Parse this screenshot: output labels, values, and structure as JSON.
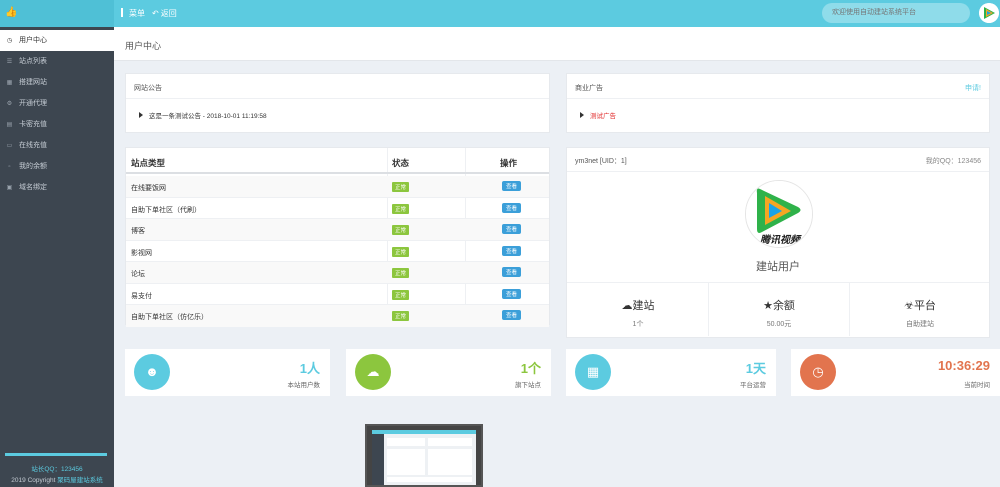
{
  "header": {
    "menu_label": "菜单",
    "back_label": "返回",
    "search_placeholder": "欢迎使用自动建站系统平台"
  },
  "sidebar": {
    "items": [
      {
        "label": "用户中心",
        "icon": "clock-icon"
      },
      {
        "label": "站点列表",
        "icon": "list-icon"
      },
      {
        "label": "搭建网站",
        "icon": "cart-icon"
      },
      {
        "label": "开通代理",
        "icon": "gear-icon"
      },
      {
        "label": "卡密充值",
        "icon": "document-icon"
      },
      {
        "label": "在线充值",
        "icon": "card-icon"
      },
      {
        "label": "我的余额",
        "icon": "wallet-icon"
      },
      {
        "label": "域名绑定",
        "icon": "lock-icon"
      }
    ],
    "qq_text": "站长QQ：123456",
    "copyright_prefix": "2019 Copyright",
    "copyright_link": "聚码屋建站系统"
  },
  "page": {
    "title": "用户中心"
  },
  "announcement": {
    "title": "网站公告",
    "item": "这是一条测试公告 - 2018-10-01 11:19:58"
  },
  "ads": {
    "title": "商业广告",
    "apply_label": "申请!",
    "item": "测试广告"
  },
  "site_table": {
    "headers": {
      "type": "站点类型",
      "status": "状态",
      "action": "操作"
    },
    "status_label": "正常",
    "view_label": "查看",
    "rows": [
      {
        "name": "在线要饭网"
      },
      {
        "name": "自助下单社区（代刷）"
      },
      {
        "name": "博客"
      },
      {
        "name": "影视网"
      },
      {
        "name": "论坛"
      },
      {
        "name": "易支付"
      },
      {
        "name": "自助下单社区（仿亿乐）"
      }
    ]
  },
  "profile": {
    "username": "ym3net [UID：1]",
    "qq": "我的QQ：123456",
    "role": "建站用户",
    "avatar_text": "腾讯视频",
    "stats": [
      {
        "icon": "cloud-icon",
        "label": "建站",
        "value": "1个"
      },
      {
        "icon": "star-icon",
        "label": "余额",
        "value": "50.00元"
      },
      {
        "icon": "user-group-icon",
        "label": "平台",
        "value": "自助建站"
      }
    ]
  },
  "cards": [
    {
      "icon": "users-icon",
      "value": "1人",
      "label": "本站用户数",
      "color": "#5ccbe0",
      "value_color": "#5ccbe0"
    },
    {
      "icon": "cloud-icon",
      "value": "1个",
      "label": "旗下站点",
      "color": "#8cc63e",
      "value_color": "#8cc63e"
    },
    {
      "icon": "calendar-icon",
      "value": "1天",
      "label": "平台运营",
      "color": "#5ccbe0",
      "value_color": "#5ccbe0"
    },
    {
      "icon": "clock-icon",
      "value": "10:36:29",
      "label": "当前时间",
      "color": "#e2744e",
      "value_color": "#e2744e"
    }
  ]
}
